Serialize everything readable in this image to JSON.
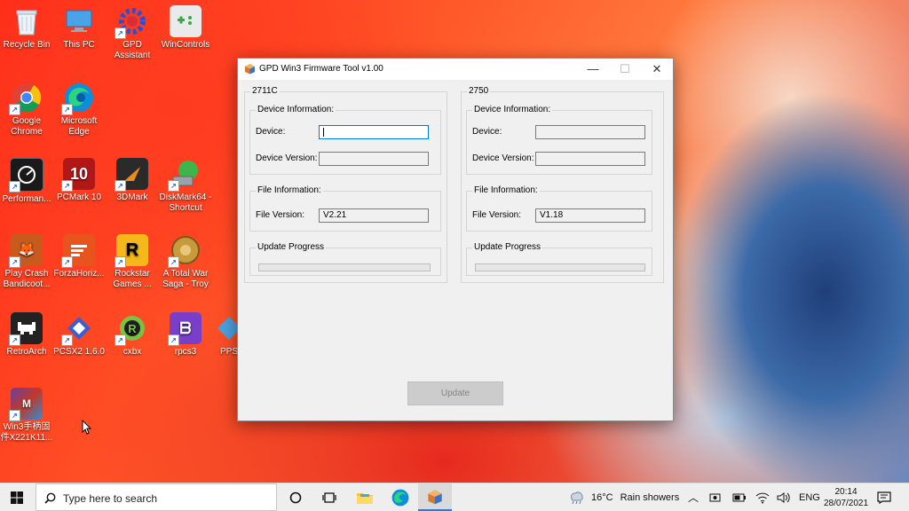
{
  "desktop": {
    "icons": [
      {
        "label": "Recycle Bin"
      },
      {
        "label": "This PC"
      },
      {
        "label": "GPD Assistant"
      },
      {
        "label": "WinControls"
      },
      {
        "label": "Google Chrome"
      },
      {
        "label": "Microsoft Edge"
      },
      {
        "label": "Performan..."
      },
      {
        "label": "PCMark 10"
      },
      {
        "label": "3DMark"
      },
      {
        "label": "DiskMark64 - Shortcut"
      },
      {
        "label": "Play Crash Bandicoot..."
      },
      {
        "label": "ForzaHoriz..."
      },
      {
        "label": "Rockstar Games ..."
      },
      {
        "label": "A Total War Saga - Troy"
      },
      {
        "label": "RetroArch"
      },
      {
        "label": "PCSX2 1.6.0"
      },
      {
        "label": "cxbx"
      },
      {
        "label": "rpcs3"
      },
      {
        "label": "PPS"
      },
      {
        "label": "Win3手柄固件X221K11..."
      }
    ]
  },
  "window": {
    "title": "GPD Win3 Firmware Tool v1.00",
    "controls": {
      "minimize": "—",
      "maximize": "☐",
      "close": "✕"
    },
    "panels": [
      {
        "heading": "2711C",
        "device_info": {
          "legend": "Device Information:",
          "device_label": "Device:",
          "device_value": "",
          "version_label": "Device Version:",
          "version_value": ""
        },
        "file_info": {
          "legend": "File Information:",
          "file_version_label": "File Version:",
          "file_version_value": "V2.21"
        },
        "progress": {
          "legend": "Update Progress",
          "value": 0
        }
      },
      {
        "heading": "2750",
        "device_info": {
          "legend": "Device Information:",
          "device_label": "Device:",
          "device_value": "",
          "version_label": "Device Version:",
          "version_value": ""
        },
        "file_info": {
          "legend": "File Information:",
          "file_version_label": "File Version:",
          "file_version_value": "V1.18"
        },
        "progress": {
          "legend": "Update Progress",
          "value": 0
        }
      }
    ],
    "update_button": "Update"
  },
  "taskbar": {
    "search_placeholder": "Type here to search",
    "weather_temp": "16°C",
    "weather_desc": "Rain showers",
    "language": "ENG",
    "time": "20:14",
    "date": "28/07/2021"
  }
}
